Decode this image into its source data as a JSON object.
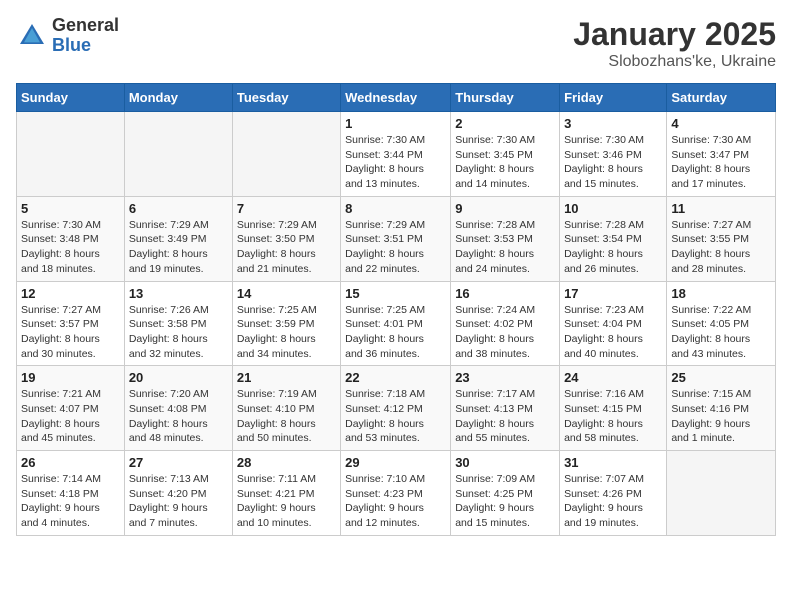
{
  "logo": {
    "general": "General",
    "blue": "Blue"
  },
  "header": {
    "month": "January 2025",
    "location": "Slobozhans'ke, Ukraine"
  },
  "weekdays": [
    "Sunday",
    "Monday",
    "Tuesday",
    "Wednesday",
    "Thursday",
    "Friday",
    "Saturday"
  ],
  "weeks": [
    [
      {
        "day": "",
        "info": ""
      },
      {
        "day": "",
        "info": ""
      },
      {
        "day": "",
        "info": ""
      },
      {
        "day": "1",
        "info": "Sunrise: 7:30 AM\nSunset: 3:44 PM\nDaylight: 8 hours\nand 13 minutes."
      },
      {
        "day": "2",
        "info": "Sunrise: 7:30 AM\nSunset: 3:45 PM\nDaylight: 8 hours\nand 14 minutes."
      },
      {
        "day": "3",
        "info": "Sunrise: 7:30 AM\nSunset: 3:46 PM\nDaylight: 8 hours\nand 15 minutes."
      },
      {
        "day": "4",
        "info": "Sunrise: 7:30 AM\nSunset: 3:47 PM\nDaylight: 8 hours\nand 17 minutes."
      }
    ],
    [
      {
        "day": "5",
        "info": "Sunrise: 7:30 AM\nSunset: 3:48 PM\nDaylight: 8 hours\nand 18 minutes."
      },
      {
        "day": "6",
        "info": "Sunrise: 7:29 AM\nSunset: 3:49 PM\nDaylight: 8 hours\nand 19 minutes."
      },
      {
        "day": "7",
        "info": "Sunrise: 7:29 AM\nSunset: 3:50 PM\nDaylight: 8 hours\nand 21 minutes."
      },
      {
        "day": "8",
        "info": "Sunrise: 7:29 AM\nSunset: 3:51 PM\nDaylight: 8 hours\nand 22 minutes."
      },
      {
        "day": "9",
        "info": "Sunrise: 7:28 AM\nSunset: 3:53 PM\nDaylight: 8 hours\nand 24 minutes."
      },
      {
        "day": "10",
        "info": "Sunrise: 7:28 AM\nSunset: 3:54 PM\nDaylight: 8 hours\nand 26 minutes."
      },
      {
        "day": "11",
        "info": "Sunrise: 7:27 AM\nSunset: 3:55 PM\nDaylight: 8 hours\nand 28 minutes."
      }
    ],
    [
      {
        "day": "12",
        "info": "Sunrise: 7:27 AM\nSunset: 3:57 PM\nDaylight: 8 hours\nand 30 minutes."
      },
      {
        "day": "13",
        "info": "Sunrise: 7:26 AM\nSunset: 3:58 PM\nDaylight: 8 hours\nand 32 minutes."
      },
      {
        "day": "14",
        "info": "Sunrise: 7:25 AM\nSunset: 3:59 PM\nDaylight: 8 hours\nand 34 minutes."
      },
      {
        "day": "15",
        "info": "Sunrise: 7:25 AM\nSunset: 4:01 PM\nDaylight: 8 hours\nand 36 minutes."
      },
      {
        "day": "16",
        "info": "Sunrise: 7:24 AM\nSunset: 4:02 PM\nDaylight: 8 hours\nand 38 minutes."
      },
      {
        "day": "17",
        "info": "Sunrise: 7:23 AM\nSunset: 4:04 PM\nDaylight: 8 hours\nand 40 minutes."
      },
      {
        "day": "18",
        "info": "Sunrise: 7:22 AM\nSunset: 4:05 PM\nDaylight: 8 hours\nand 43 minutes."
      }
    ],
    [
      {
        "day": "19",
        "info": "Sunrise: 7:21 AM\nSunset: 4:07 PM\nDaylight: 8 hours\nand 45 minutes."
      },
      {
        "day": "20",
        "info": "Sunrise: 7:20 AM\nSunset: 4:08 PM\nDaylight: 8 hours\nand 48 minutes."
      },
      {
        "day": "21",
        "info": "Sunrise: 7:19 AM\nSunset: 4:10 PM\nDaylight: 8 hours\nand 50 minutes."
      },
      {
        "day": "22",
        "info": "Sunrise: 7:18 AM\nSunset: 4:12 PM\nDaylight: 8 hours\nand 53 minutes."
      },
      {
        "day": "23",
        "info": "Sunrise: 7:17 AM\nSunset: 4:13 PM\nDaylight: 8 hours\nand 55 minutes."
      },
      {
        "day": "24",
        "info": "Sunrise: 7:16 AM\nSunset: 4:15 PM\nDaylight: 8 hours\nand 58 minutes."
      },
      {
        "day": "25",
        "info": "Sunrise: 7:15 AM\nSunset: 4:16 PM\nDaylight: 9 hours\nand 1 minute."
      }
    ],
    [
      {
        "day": "26",
        "info": "Sunrise: 7:14 AM\nSunset: 4:18 PM\nDaylight: 9 hours\nand 4 minutes."
      },
      {
        "day": "27",
        "info": "Sunrise: 7:13 AM\nSunset: 4:20 PM\nDaylight: 9 hours\nand 7 minutes."
      },
      {
        "day": "28",
        "info": "Sunrise: 7:11 AM\nSunset: 4:21 PM\nDaylight: 9 hours\nand 10 minutes."
      },
      {
        "day": "29",
        "info": "Sunrise: 7:10 AM\nSunset: 4:23 PM\nDaylight: 9 hours\nand 12 minutes."
      },
      {
        "day": "30",
        "info": "Sunrise: 7:09 AM\nSunset: 4:25 PM\nDaylight: 9 hours\nand 15 minutes."
      },
      {
        "day": "31",
        "info": "Sunrise: 7:07 AM\nSunset: 4:26 PM\nDaylight: 9 hours\nand 19 minutes."
      },
      {
        "day": "",
        "info": ""
      }
    ]
  ]
}
